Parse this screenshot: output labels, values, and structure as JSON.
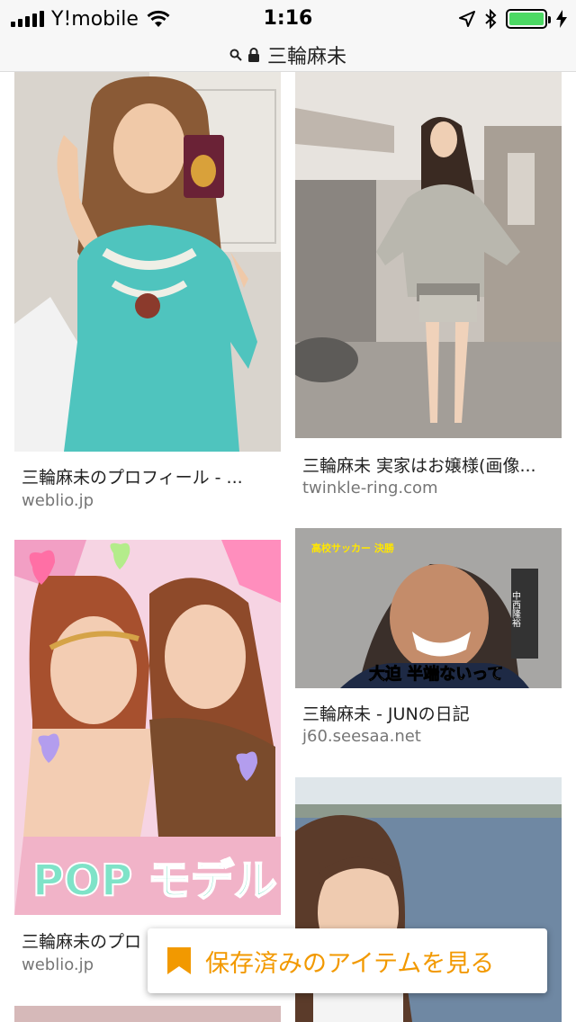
{
  "status_bar": {
    "carrier": "Y!mobile",
    "time": "1:16",
    "battery_level": 1.0
  },
  "url_bar": {
    "title": "三輪麻未",
    "icons": [
      "search-icon",
      "lock-icon"
    ]
  },
  "results": [
    {
      "caption": "三輪麻未のプロフィール - ...",
      "source": "weblio.jp"
    },
    {
      "caption": "三輪麻未 実家はお嬢様(画像...",
      "source": "twinkle-ring.com"
    },
    {
      "caption": "三輪麻未のプロ",
      "source": "weblio.jp"
    },
    {
      "caption": "三輪麻未 - JUNの日記",
      "source": "j60.seesaa.net"
    }
  ],
  "image_overlays": {
    "purikura_text": "POP モデル",
    "news_banner": "高校サッカー 決勝",
    "news_subtitle": "大迫 半端ないって",
    "news_name": "中西隆裕"
  },
  "toast": {
    "label": "保存済みのアイテムを見る",
    "icon": "bookmark-icon"
  },
  "colors": {
    "accent": "#f29900",
    "source_text": "#767676",
    "battery": "#4cd964"
  }
}
